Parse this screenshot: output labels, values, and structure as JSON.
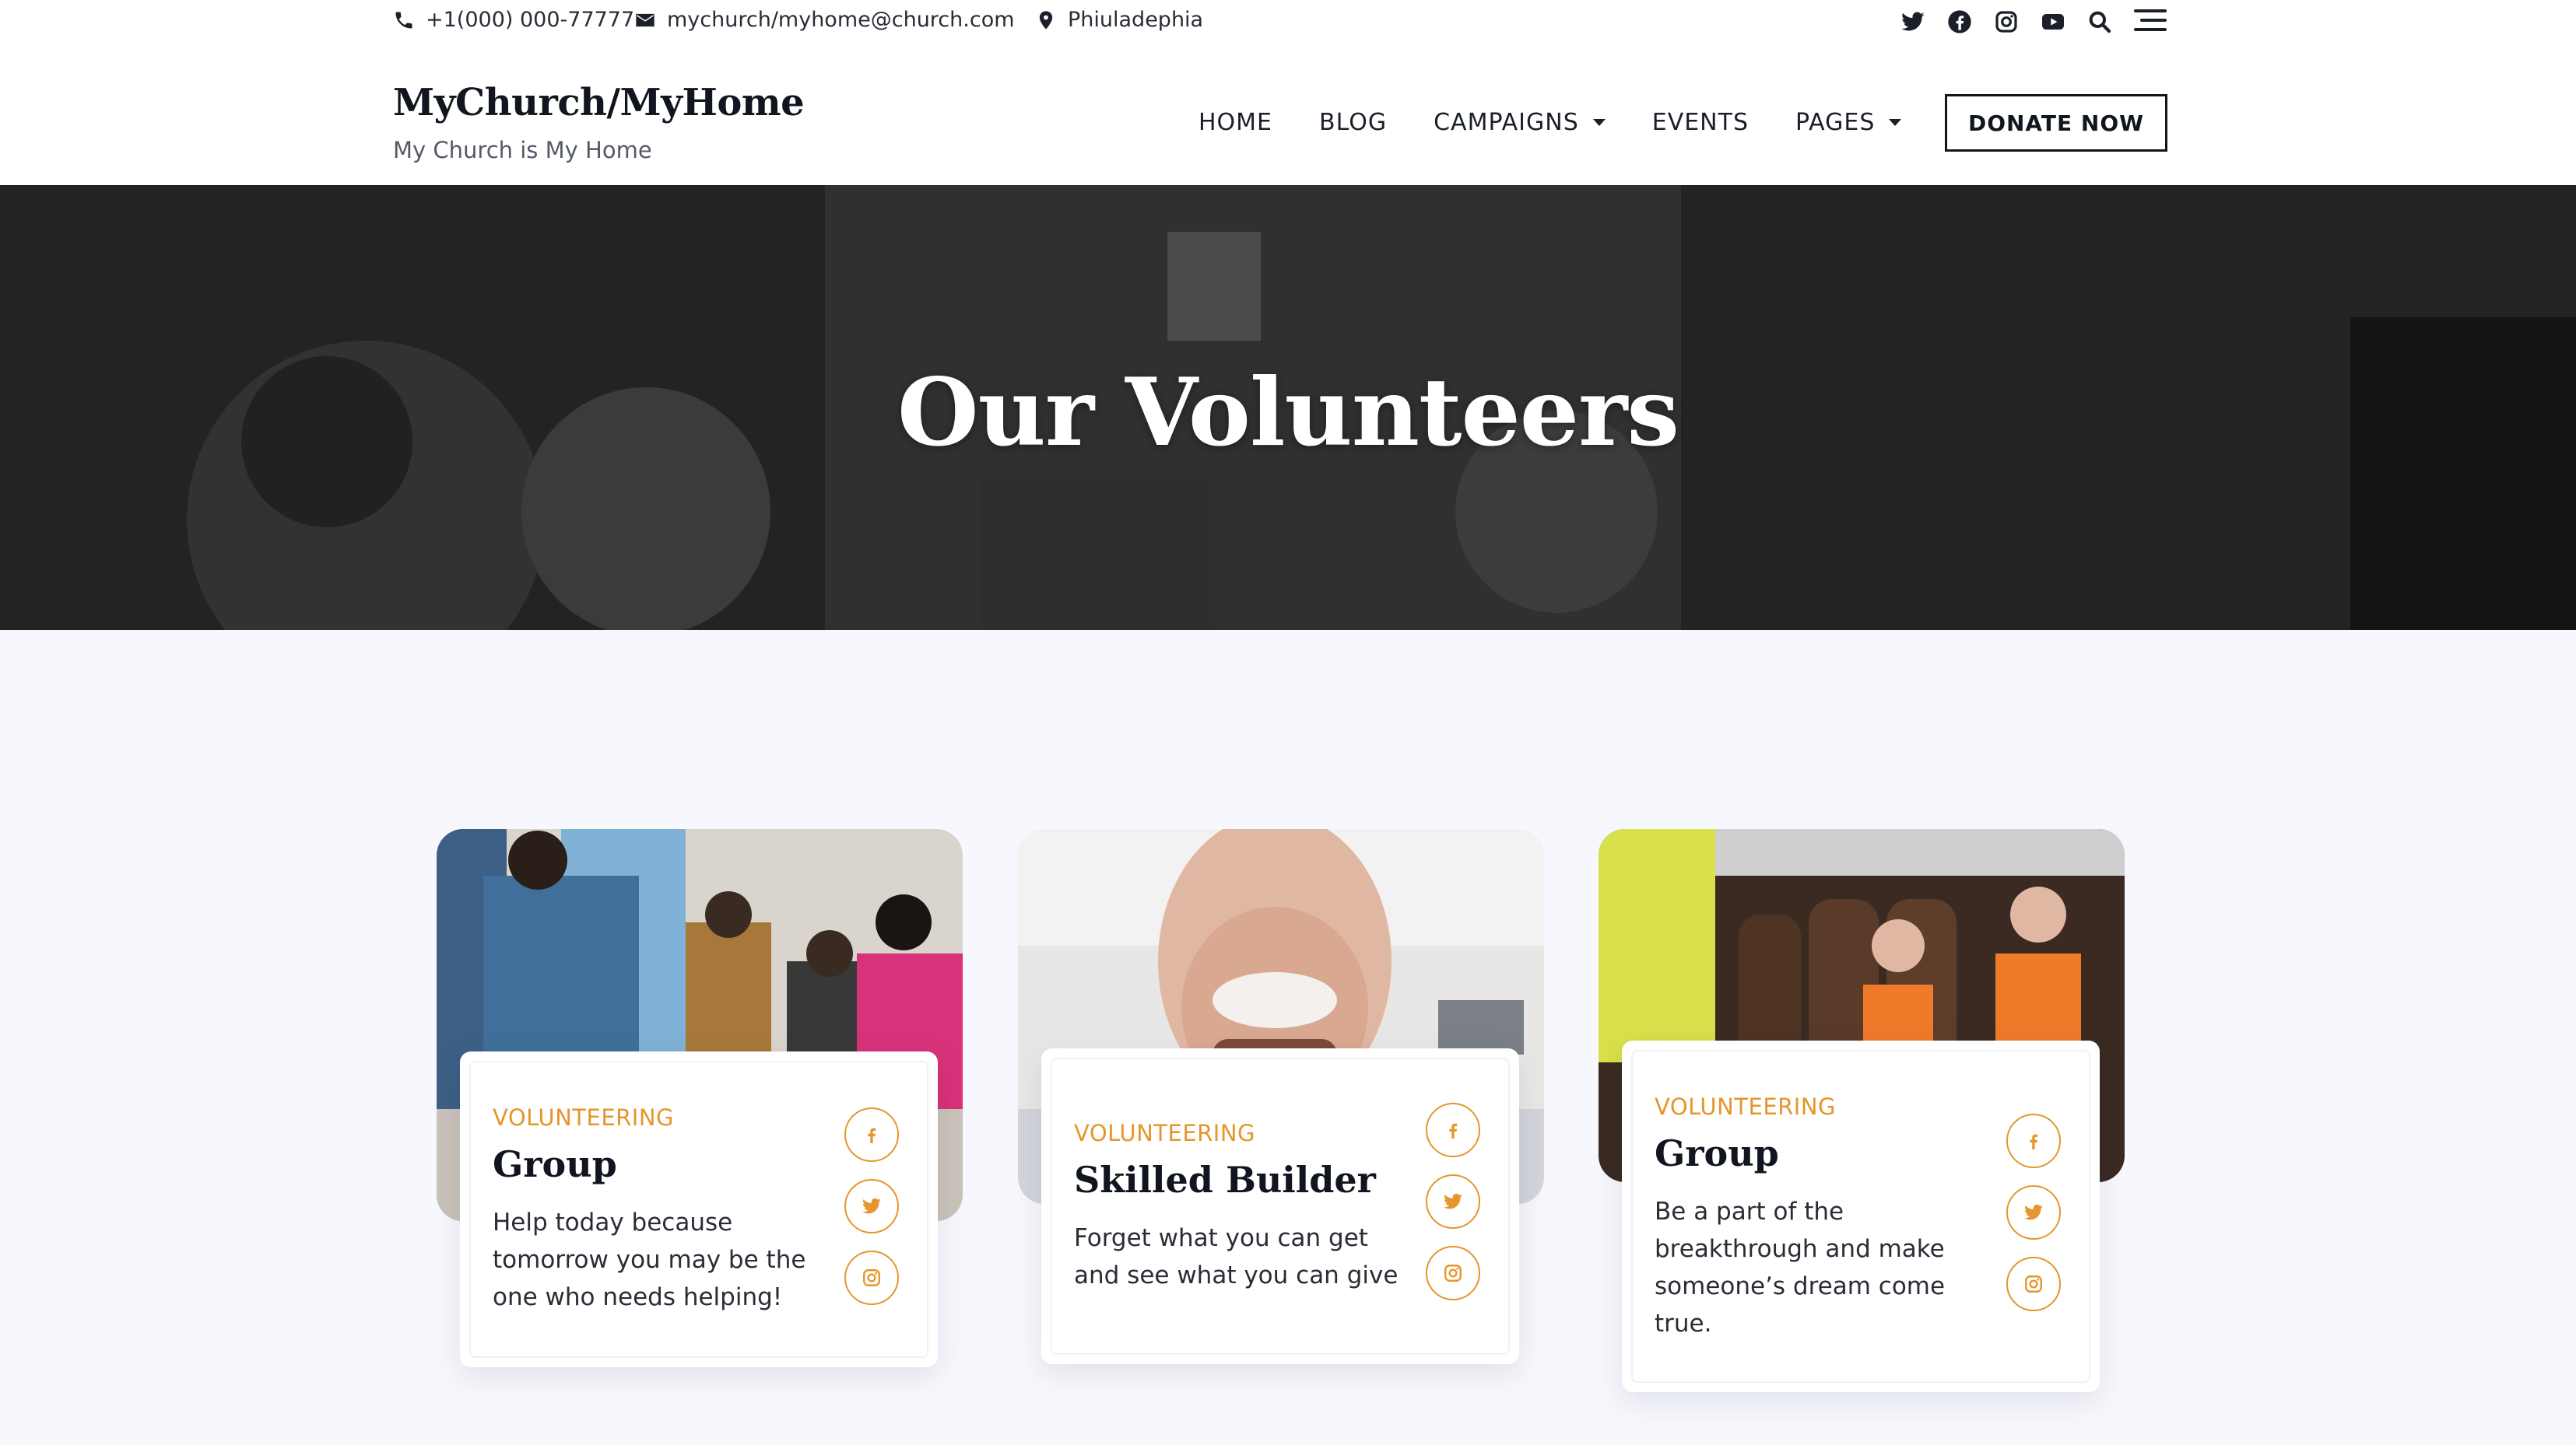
{
  "topbar": {
    "phone": "+1(000) 000-77777",
    "email": "mychurch/myhome@church.com",
    "location": "Phiuladephia"
  },
  "header": {
    "brand": "MyChurch/MyHome",
    "tagline": "My Church is My Home",
    "nav": [
      "HOME",
      "BLOG",
      "CAMPAIGNS",
      "EVENTS",
      "PAGES"
    ],
    "donate_label": "DONATE NOW"
  },
  "hero": {
    "title": "Our Volunteers"
  },
  "cards": [
    {
      "category": "VOLUNTEERING",
      "title": "Group",
      "description": "Help today because tomorrow you may be the one who needs helping!"
    },
    {
      "category": "VOLUNTEERING",
      "title": "Skilled Builder",
      "description": "Forget what you can get and see what you can give"
    },
    {
      "category": "VOLUNTEERING",
      "title": "Group",
      "description": "Be a part of the breakthrough and make someone’s dream come true."
    }
  ],
  "colors": {
    "accent": "#e5962c",
    "dark": "#11151f",
    "background": "#f7f8fd"
  },
  "icons": [
    "phone-icon",
    "email-icon",
    "location-pin-icon",
    "twitter-icon",
    "facebook-icon",
    "instagram-icon",
    "youtube-icon",
    "search-icon",
    "hamburger-menu-icon"
  ]
}
